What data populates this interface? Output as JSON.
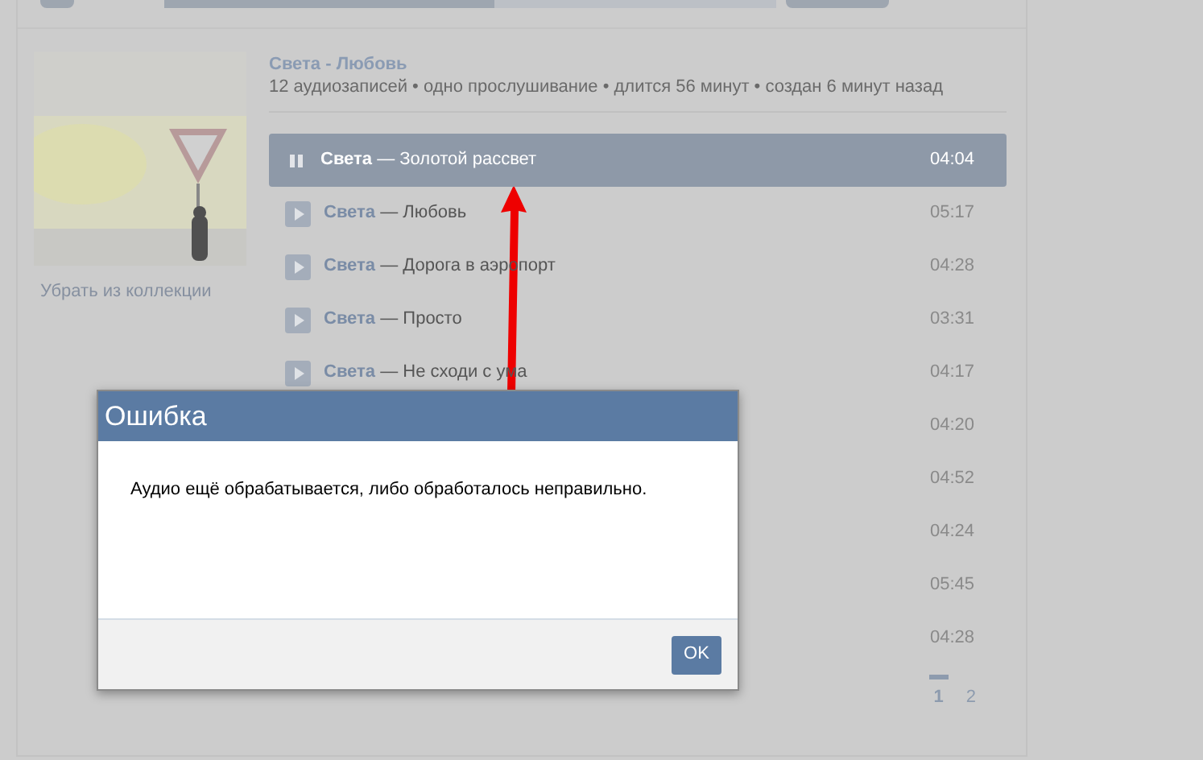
{
  "player": {
    "level": 0.54
  },
  "album": {
    "remove_link": "Убрать из коллекции",
    "title": "Света - Любовь",
    "meta": "12 аудиозаписей • одно прослушивание • длится 56 минут • создан 6 минут назад"
  },
  "tracks": [
    {
      "artist": "Света",
      "title": "— Золотой рассвет",
      "duration": "04:04",
      "selected": true
    },
    {
      "artist": "Света",
      "title": "— Любовь",
      "duration": "05:17",
      "selected": false
    },
    {
      "artist": "Света",
      "title": "— Дорога в аэропорт",
      "duration": "04:28",
      "selected": false
    },
    {
      "artist": "Света",
      "title": "— Просто",
      "duration": "03:31",
      "selected": false
    },
    {
      "artist": "Света",
      "title": "— Не сходи с ума",
      "duration": "04:17",
      "selected": false
    },
    {
      "duration": "04:20",
      "selected": false
    },
    {
      "duration": "04:52",
      "selected": false
    },
    {
      "duration": "04:24",
      "selected": false
    },
    {
      "duration": "05:45",
      "selected": false
    },
    {
      "duration": "04:28",
      "selected": false
    }
  ],
  "pagination": [
    {
      "label": "1",
      "selected": true
    },
    {
      "label": "2",
      "selected": false
    }
  ],
  "dialog": {
    "title": "Ошибка",
    "message": "Аудио ещё обрабатывается, либо обработалось неправильно.",
    "button": "OK"
  }
}
